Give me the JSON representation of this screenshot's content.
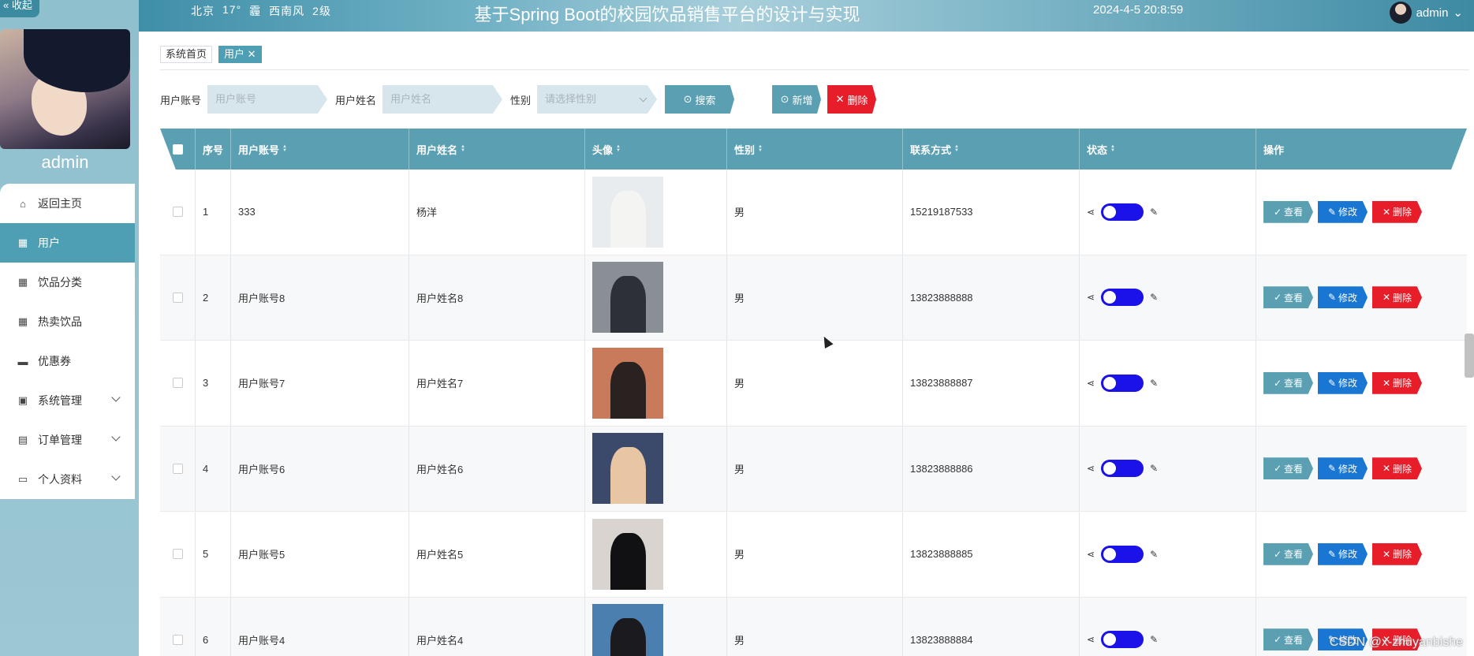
{
  "header": {
    "city": "北京",
    "temp": "17°",
    "weather": "霾",
    "wind": "西南风",
    "wind_level": "2级",
    "title": "基于Spring Boot的校园饮品销售平台的设计与实现",
    "datetime": "2024-4-5 20:8:59",
    "username": "admin"
  },
  "sidebar": {
    "collapse_label": "« 收起",
    "name": "admin",
    "items": [
      {
        "label": "返回主页",
        "icon": "home-icon",
        "glyph": "⌂",
        "expand": false
      },
      {
        "label": "用户",
        "icon": "grid-icon",
        "glyph": "▦",
        "expand": false
      },
      {
        "label": "饮品分类",
        "icon": "grid-icon",
        "glyph": "▦",
        "expand": false
      },
      {
        "label": "热卖饮品",
        "icon": "grid-icon",
        "glyph": "▦",
        "expand": false
      },
      {
        "label": "优惠券",
        "icon": "monitor-icon",
        "glyph": "▬",
        "expand": false
      },
      {
        "label": "系统管理",
        "icon": "briefcase-icon",
        "glyph": "▣",
        "expand": true
      },
      {
        "label": "订单管理",
        "icon": "clipboard-icon",
        "glyph": "▤",
        "expand": true
      },
      {
        "label": "个人资料",
        "icon": "card-icon",
        "glyph": "▭",
        "expand": true
      }
    ]
  },
  "tags": {
    "home": "系统首页",
    "current": "用户 ✕"
  },
  "search": {
    "account_label": "用户账号",
    "account_placeholder": "用户账号",
    "name_label": "用户姓名",
    "name_placeholder": "用户姓名",
    "gender_label": "性别",
    "gender_placeholder": "请选择性别",
    "search_button": "搜索",
    "add_button": "新增",
    "delete_button": "删除"
  },
  "table": {
    "headers": [
      "序号",
      "用户账号",
      "用户姓名",
      "头像",
      "性别",
      "联系方式",
      "状态",
      "操作"
    ],
    "rows": [
      {
        "index": "1",
        "account": "333",
        "name": "杨洋",
        "gender": "男",
        "phone": "15219187533"
      },
      {
        "index": "2",
        "account": "用户账号8",
        "name": "用户姓名8",
        "gender": "男",
        "phone": "13823888888"
      },
      {
        "index": "3",
        "account": "用户账号7",
        "name": "用户姓名7",
        "gender": "男",
        "phone": "13823888887"
      },
      {
        "index": "4",
        "account": "用户账号6",
        "name": "用户姓名6",
        "gender": "男",
        "phone": "13823888886"
      },
      {
        "index": "5",
        "account": "用户账号5",
        "name": "用户姓名5",
        "gender": "男",
        "phone": "13823888885"
      },
      {
        "index": "6",
        "account": "用户账号4",
        "name": "用户姓名4",
        "gender": "男",
        "phone": "13823888884"
      }
    ],
    "actions": {
      "view": "查看",
      "edit": "修改",
      "delete": "删除"
    }
  },
  "watermark": "CSDN @x-zhuyanbishe"
}
